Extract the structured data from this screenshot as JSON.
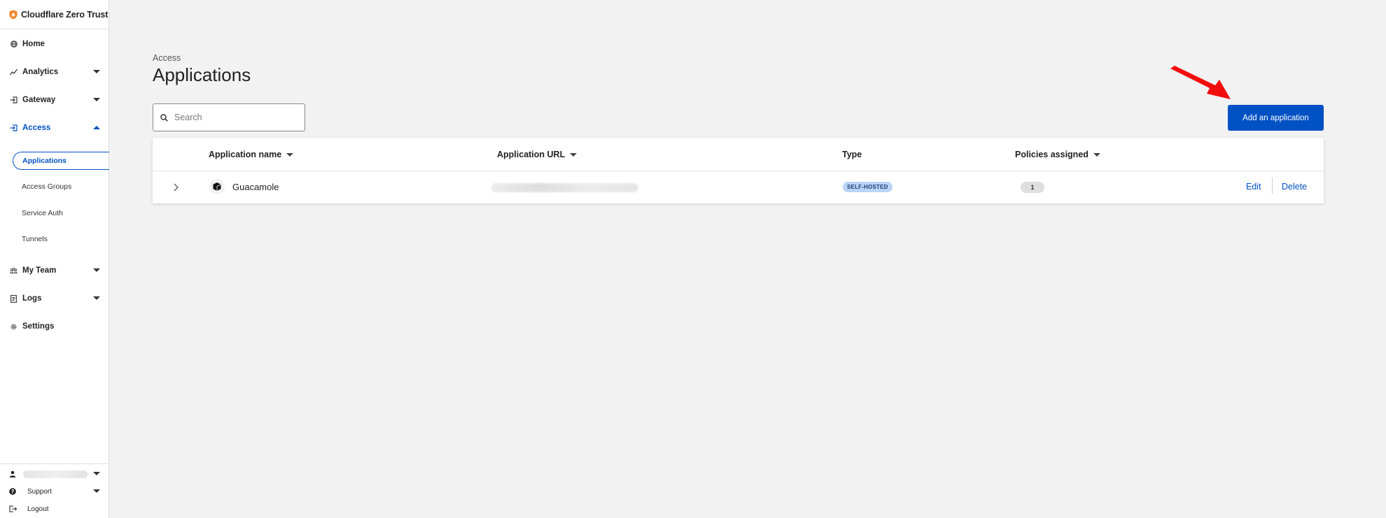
{
  "brand": {
    "name": "Cloudflare Zero Trust",
    "accent": "#f38020"
  },
  "sidebar": {
    "items": [
      {
        "label": "Home",
        "icon": "globe-icon"
      },
      {
        "label": "Analytics",
        "icon": "chart-line-icon"
      },
      {
        "label": "Gateway",
        "icon": "gateway-icon"
      },
      {
        "label": "Access",
        "icon": "access-icon"
      },
      {
        "label": "My Team",
        "icon": "team-icon"
      },
      {
        "label": "Logs",
        "icon": "logs-icon"
      },
      {
        "label": "Settings",
        "icon": "gear-icon"
      }
    ],
    "access_subitems": [
      "Applications",
      "Access Groups",
      "Service Auth",
      "Tunnels"
    ],
    "active_item": "Access",
    "selected_subitem": "Applications"
  },
  "footer": {
    "support_label": "Support",
    "logout_label": "Logout"
  },
  "main": {
    "breadcrumb": "Access",
    "title": "Applications",
    "search_placeholder": "Search",
    "add_button_label": "Add an application",
    "primary_color": "#0051c3"
  },
  "table": {
    "columns": [
      "Application name",
      "Application URL",
      "Type",
      "Policies assigned"
    ],
    "rows": [
      {
        "name": "Guacamole",
        "type": "SELF-HOSTED",
        "policies": "1",
        "edit_label": "Edit",
        "delete_label": "Delete"
      }
    ]
  }
}
